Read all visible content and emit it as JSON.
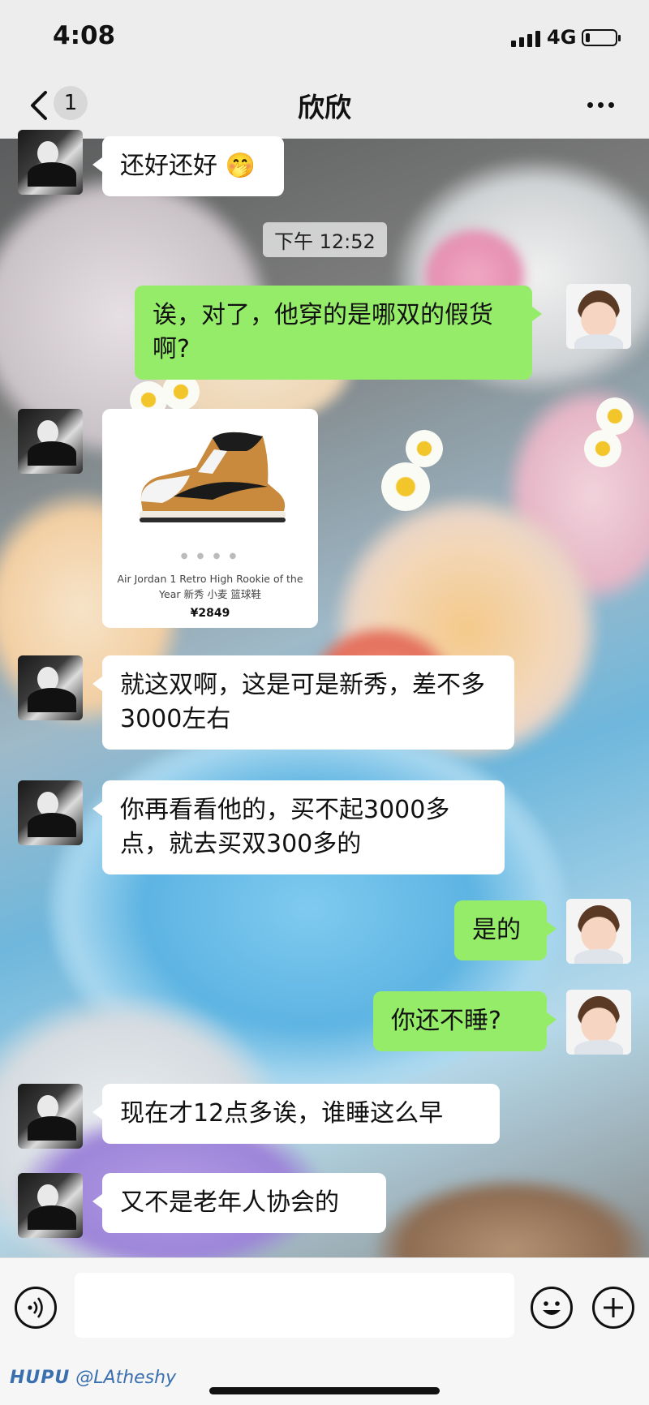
{
  "status_bar": {
    "time": "4:08",
    "network": "4G",
    "battery_level": 0.15
  },
  "nav": {
    "unread_count": "1",
    "title": "欣欣"
  },
  "messages": [
    {
      "side": "in",
      "text": "还好还好 🤭"
    },
    {
      "type": "timestamp",
      "text": "下午 12:52"
    },
    {
      "side": "out",
      "text": "诶，对了，他穿的是哪双的假货啊?"
    },
    {
      "side": "in",
      "type": "product_card",
      "name": "Air Jordan 1 Retro High Rookie of the Year 新秀 小麦 篮球鞋",
      "price": "¥2849"
    },
    {
      "side": "in",
      "text": "就这双啊，这是可是新秀，差不多3000左右"
    },
    {
      "side": "in",
      "text": "你再看看他的，买不起3000多点，就去买双300多的"
    },
    {
      "side": "out",
      "text": "是的"
    },
    {
      "side": "out",
      "text": "你还不睡?"
    },
    {
      "side": "in",
      "text": "现在才12点多诶，谁睡这么早"
    },
    {
      "side": "in",
      "text": "又不是老年人协会的"
    }
  ],
  "input_bar": {
    "icons": [
      "voice-icon",
      "emoji-icon",
      "plus-icon"
    ]
  },
  "watermark": {
    "brand": "HUPU",
    "user": "@LAtheshy"
  },
  "colors": {
    "outgoing_bubble": "#95ec69",
    "incoming_bubble": "#ffffff",
    "bar_bg": "#ededed"
  }
}
